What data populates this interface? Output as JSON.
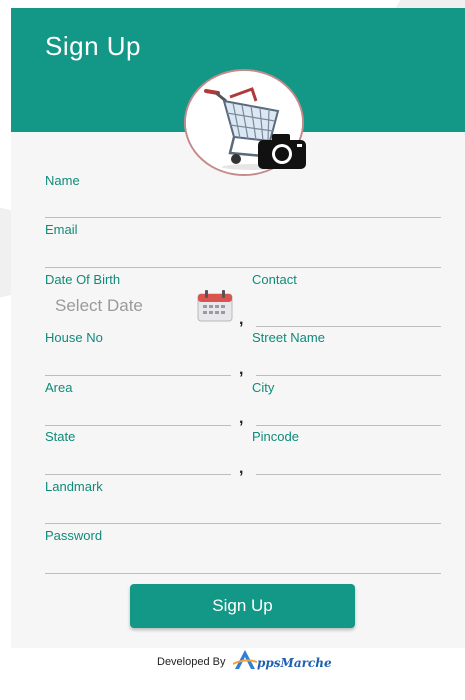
{
  "header": {
    "title": "Sign Up"
  },
  "form": {
    "name_label": "Name",
    "email_label": "Email",
    "dob_label": "Date Of Birth",
    "dob_placeholder": "Select Date",
    "contact_label": "Contact",
    "house_label": "House No",
    "street_label": "Street Name",
    "area_label": "Area",
    "city_label": "City",
    "state_label": "State",
    "pincode_label": "Pincode",
    "landmark_label": "Landmark",
    "password_label": "Password",
    "separator": ","
  },
  "actions": {
    "signup_label": "Sign Up"
  },
  "footer": {
    "developed_by": "Developed By",
    "brand": "ppsMarche",
    "brand_color": "#1e5fb0"
  },
  "theme": {
    "primary": "#139786",
    "label": "#0f8b7a",
    "background": "#f6f6f6"
  },
  "icons": {
    "avatar": "shopping-cart-icon",
    "camera": "camera-icon",
    "calendar": "calendar-icon"
  }
}
